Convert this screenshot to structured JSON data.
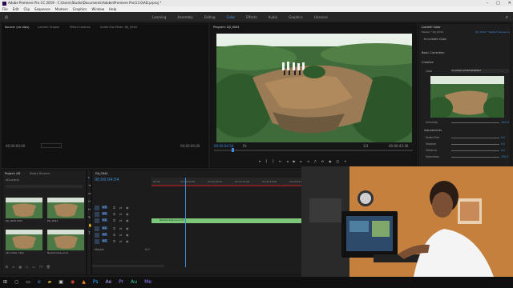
{
  "titlebar": {
    "text": "Adobe Premiere Pro CC 2019 - C:\\Users\\Studio\\Documents\\Adobe\\Premiere Pro\\13.0\\AD.prproj *"
  },
  "menu": [
    "File",
    "Edit",
    "Clip",
    "Sequence",
    "Markers",
    "Graphics",
    "Window",
    "Help"
  ],
  "workspaces": {
    "tabs": [
      "Learning",
      "Assembly",
      "Editing",
      "Color",
      "Effects",
      "Audio",
      "Graphics",
      "Libraries"
    ],
    "active": "Color"
  },
  "source": {
    "tabs": [
      "Source: (no clips)",
      "Lumetri Scopes",
      "Effect Controls",
      "Audio Clip Mixer: DJI_0044"
    ],
    "timecode_left": "00;00;00;00",
    "timecode_right": "00;00;00;00"
  },
  "program": {
    "tab": "Program: DJI_0044",
    "timecode_left": "00:00:04:54",
    "fit": "Fit",
    "scale": "1/2",
    "timecode_right": "00:00:43:36"
  },
  "lumetri": {
    "tab": "Lumetri Color",
    "master": "Master * DJI_0044",
    "seq": "DJI_0044 * Nested Sequence",
    "effect": "fx Lumetri Color",
    "basic": "Basic Correction",
    "creative": "Creative",
    "look_label": "Look",
    "look_value": "CineSpace2383sRGB6bit",
    "intensity_label": "Intensity",
    "intensity_value": "100.0",
    "adjustments": "Adjustments",
    "sliders": [
      {
        "label": "Faded Film",
        "value": "0.0"
      },
      {
        "label": "Sharpen",
        "value": "0.0"
      },
      {
        "label": "Vibrance",
        "value": "0.0"
      },
      {
        "label": "Saturation",
        "value": "100.0"
      }
    ]
  },
  "project": {
    "tabs": [
      "Project: AD",
      "Media Browser"
    ],
    "file": "AD.prproj",
    "items": [
      {
        "name": "DJI_0044.MOV",
        "dur": ""
      },
      {
        "name": "DJI_0044",
        "dur": ""
      },
      {
        "name": "AD Cutter Clips",
        "dur": ""
      },
      {
        "name": "Nested Sequence",
        "dur": ""
      }
    ]
  },
  "timeline": {
    "tab": "DJI_0044",
    "timecode": "00:00:04:54",
    "ruler": [
      "00:00",
      "00:00:04:00",
      "00:00:08:00",
      "00:00:12:00",
      "00:00:16:00",
      "00:00:20:00"
    ],
    "tracks_v": [
      "V3",
      "V2",
      "V1"
    ],
    "tracks_a": [
      "A1",
      "A2",
      "A3"
    ],
    "master": "Master",
    "master_val": "0.0",
    "clip_label": "Nested Sequence 01"
  },
  "colors": {
    "accent": "#3c8bdc",
    "clip_green": "#7dc77a",
    "playhead": "#3c8bdc"
  }
}
